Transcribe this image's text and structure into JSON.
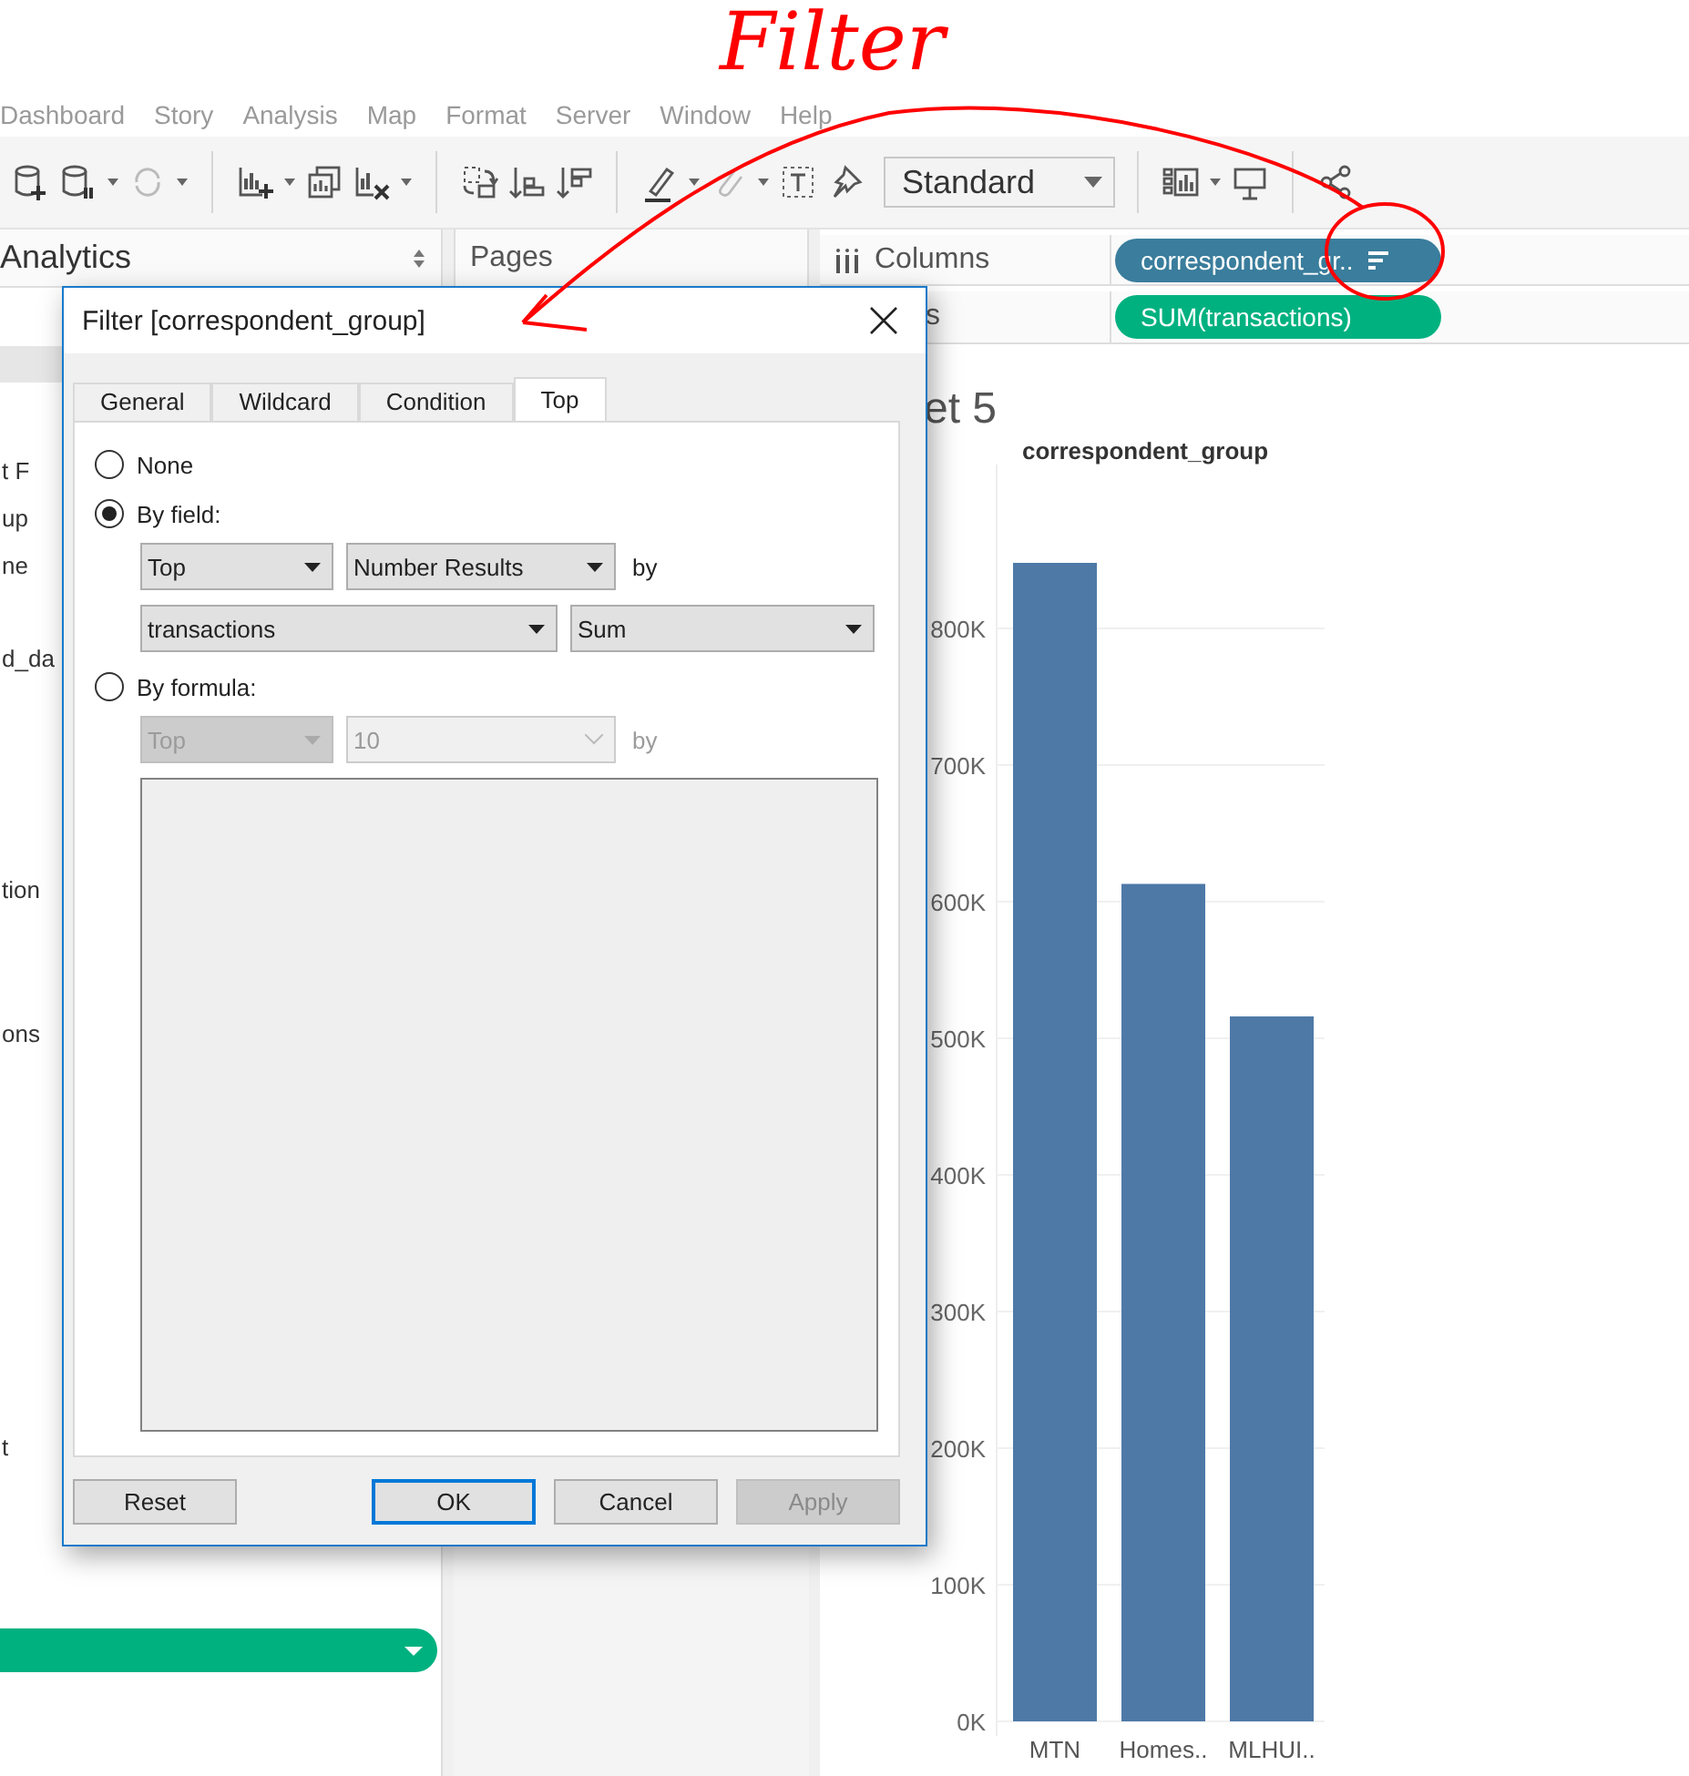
{
  "menu": [
    "Dashboard",
    "Story",
    "Analysis",
    "Map",
    "Format",
    "Server",
    "Window",
    "Help"
  ],
  "toolbar": {
    "mode": "Standard"
  },
  "left_panel": {
    "header": "Analytics",
    "fragments": [
      "t F",
      "up",
      "ne",
      "d_da",
      "tion",
      "ons",
      "t"
    ]
  },
  "pages": {
    "title": "Pages"
  },
  "shelves": [
    {
      "label": "Columns",
      "pill": "correspondent_gr..",
      "kind": "dimension",
      "sorted": true
    },
    {
      "label": "s",
      "pill": "SUM(transactions)",
      "kind": "measure",
      "sorted": false
    }
  ],
  "sheet": {
    "title": "et 5",
    "header": "correspondent_group",
    "chart_data": {
      "type": "bar",
      "categories": [
        "MTN",
        "Homes..",
        "MLHUI.."
      ],
      "values": [
        848000,
        613000,
        516000
      ],
      "ylim": [
        0,
        920000
      ],
      "grid": true,
      "yticks": [
        {
          "value": 0,
          "label": "0K"
        },
        {
          "value": 100000,
          "label": "100K"
        },
        {
          "value": 200000,
          "label": "200K"
        },
        {
          "value": 300000,
          "label": "300K"
        },
        {
          "value": 400000,
          "label": "400K"
        },
        {
          "value": 500000,
          "label": "500K"
        },
        {
          "value": 600000,
          "label": "600K"
        },
        {
          "value": 700000,
          "label": "700K"
        },
        {
          "value": 800000,
          "label": "800K"
        }
      ]
    }
  },
  "dialog": {
    "title": "Filter [correspondent_group]",
    "tabs": [
      {
        "label": "General",
        "selected": false
      },
      {
        "label": "Wildcard",
        "selected": false
      },
      {
        "label": "Condition",
        "selected": false
      },
      {
        "label": "Top",
        "selected": true
      }
    ],
    "options": [
      {
        "label": "None",
        "selected": false
      },
      {
        "label": "By field:",
        "selected": true
      },
      {
        "label": "By formula:",
        "selected": false
      }
    ],
    "by_field": {
      "rank": "Top",
      "count": "Number Results",
      "by": "by",
      "field": "transactions",
      "aggregation": "Sum"
    },
    "by_formula": {
      "rank": "Top",
      "value": "10",
      "by": "by",
      "disabled": true
    },
    "buttons": [
      {
        "label": "Reset",
        "default": false,
        "disabled": false
      },
      {
        "label": "OK",
        "default": true,
        "disabled": false
      },
      {
        "label": "Cancel",
        "default": false,
        "disabled": false
      },
      {
        "label": "Apply",
        "default": false,
        "disabled": true
      }
    ]
  },
  "annotation": {
    "text": "Filter"
  }
}
